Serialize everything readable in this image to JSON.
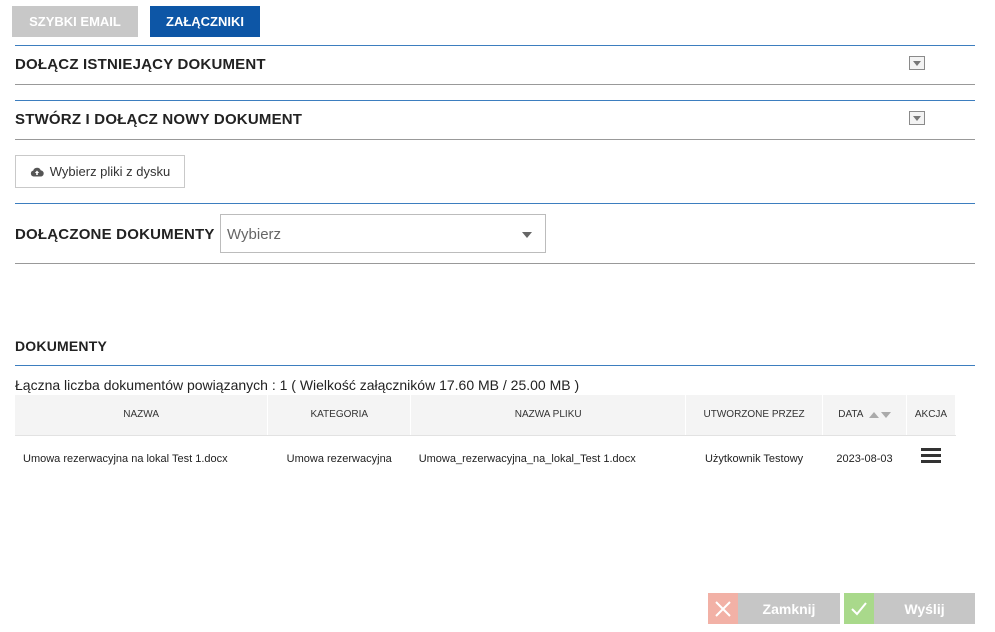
{
  "tabs": [
    {
      "label": "SZYBKI EMAIL",
      "active": false
    },
    {
      "label": "ZAŁĄCZNIKI",
      "active": true
    }
  ],
  "sections": {
    "attach_existing": "DOŁĄCZ ISTNIEJĄCY DOKUMENT",
    "create_new": "STWÓRZ I DOŁĄCZ NOWY DOKUMENT",
    "attached_docs": "DOŁĄCZONE DOKUMENTY",
    "documents": "DOKUMENTY"
  },
  "upload_button": {
    "label": "Wybierz pliki z dysku",
    "icon": "cloud-upload-icon"
  },
  "attached_select": {
    "value": "Wybierz"
  },
  "summary_text": "Łączna liczba dokumentów powiązanych : 1 ( Wielkość załączników 17.60 MB / 25.00 MB )",
  "table": {
    "headers": [
      "NAZWA",
      "KATEGORIA",
      "NAZWA PLIKU",
      "UTWORZONE PRZEZ",
      "DATA",
      "AKCJA"
    ],
    "rows": [
      {
        "name": "Umowa rezerwacyjna na lokal Test 1.docx",
        "category": "Umowa rezerwacyjna",
        "filename": "Umowa_rezerwacyjna_na_lokal_Test 1.docx",
        "created_by": "Użytkownik Testowy",
        "date": "2023-08-03"
      }
    ]
  },
  "footer": {
    "close_label": "Zamknij",
    "send_label": "Wyślij",
    "close_color": "#f2b1a6",
    "send_color": "#a9d98b"
  },
  "colors": {
    "accent": "#0d56a6",
    "divider": "#3d7ebf"
  }
}
